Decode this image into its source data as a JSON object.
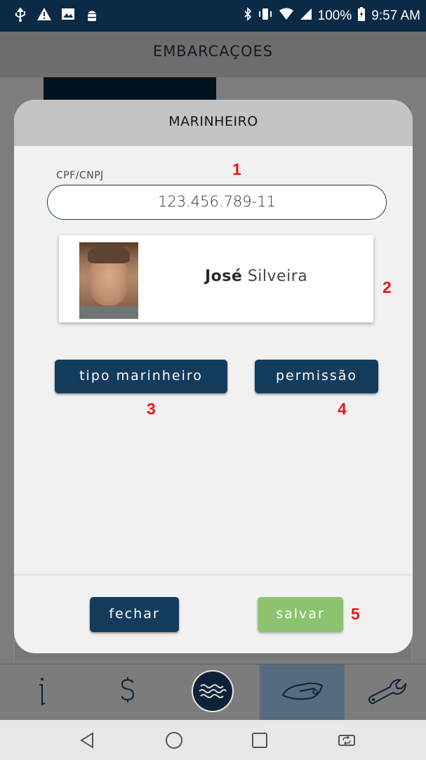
{
  "status_bar": {
    "icons_left": [
      "usb-icon",
      "warning-icon",
      "image-icon",
      "android-debug-icon"
    ],
    "battery_percent": "100%",
    "time": "9:57 AM",
    "icons_right": [
      "bluetooth-icon",
      "vibrate-icon",
      "wifi-icon",
      "signal-icon",
      "battery-icon"
    ]
  },
  "app_header": {
    "title": "EMBARCAÇOES"
  },
  "modal": {
    "title": "MARINHEIRO",
    "cpf": {
      "label": "CPF/CNPJ",
      "value": "123.456.789-11"
    },
    "person": {
      "first_name": "José",
      "last_name": "Silveira"
    },
    "buttons": {
      "tipo": "tipo marinheiro",
      "permissao": "permissão",
      "fechar": "fechar",
      "salvar": "salvar"
    }
  },
  "callouts": [
    "1",
    "2",
    "3",
    "4",
    "5"
  ],
  "bottom_nav": {
    "items": [
      "info-icon",
      "dollar-icon",
      "waves-icon",
      "boat-icon",
      "wrench-icon"
    ],
    "active": "boat-icon"
  },
  "system_nav": [
    "back-icon",
    "home-icon",
    "recents-icon",
    "rotate-icon"
  ],
  "colors": {
    "primary_dark": "#133b5c",
    "success": "#8cc36f",
    "callout": "#e0191b",
    "status_bar": "#0b2a45"
  }
}
